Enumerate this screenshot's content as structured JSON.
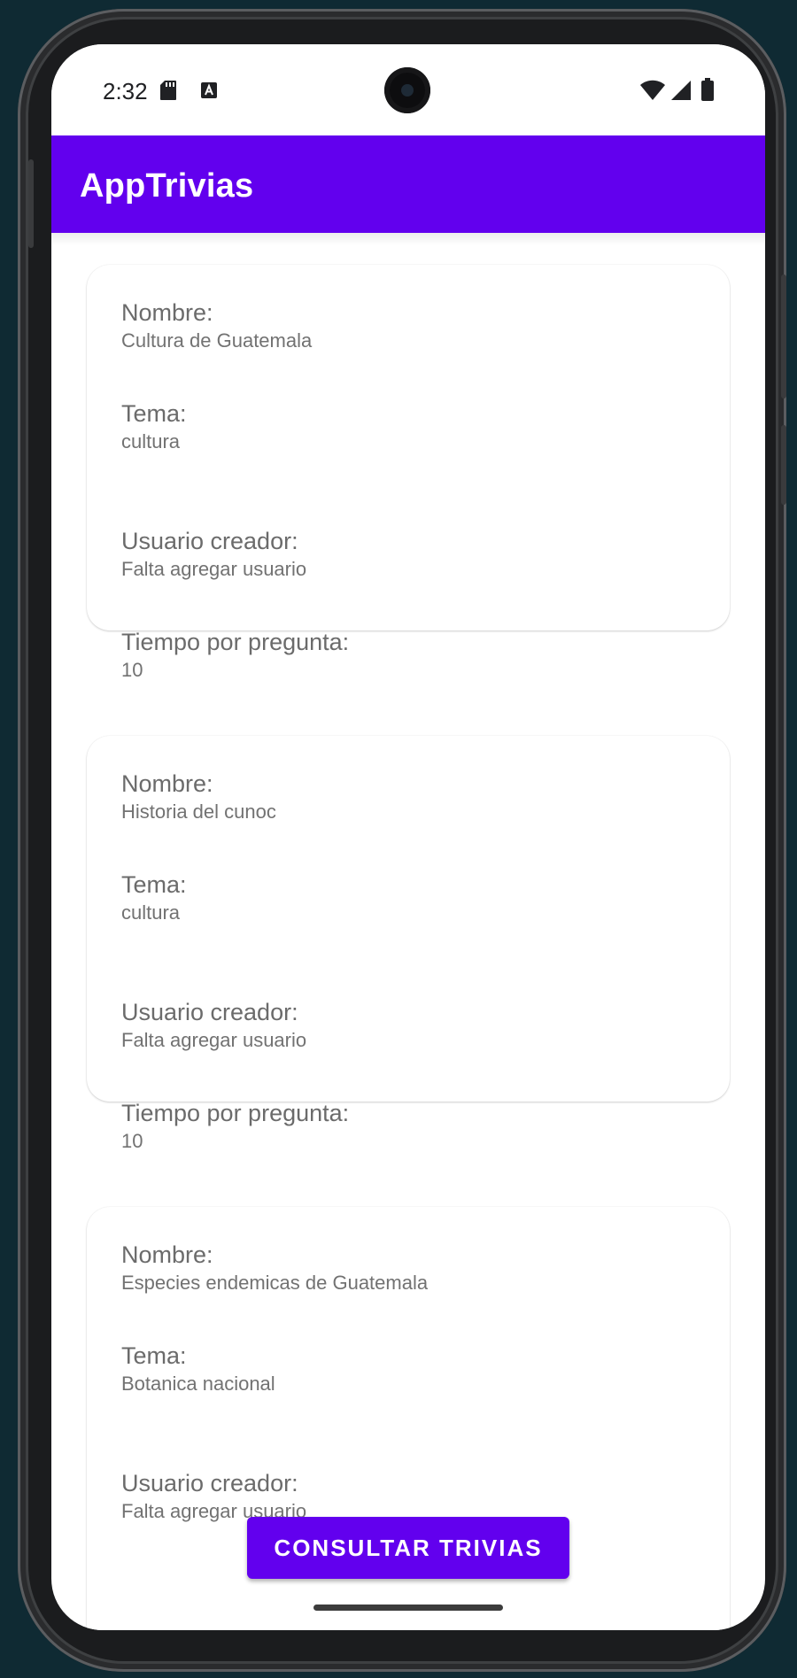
{
  "status_bar": {
    "time": "2:32",
    "icons": [
      "sd-card-icon",
      "a-icon",
      "wifi-icon",
      "signal-icon",
      "battery-icon"
    ]
  },
  "app_bar": {
    "title": "AppTrivias",
    "color": "#6200ee"
  },
  "labels": {
    "name": "Nombre:",
    "topic": "Tema:",
    "creator": "Usuario creador:",
    "time_per_question": "Tiempo por pregunta:"
  },
  "trivias": [
    {
      "name": "Cultura de Guatemala",
      "topic": "cultura",
      "creator": "Falta agregar usuario",
      "time_per_question": "10"
    },
    {
      "name": "Historia del cunoc",
      "topic": "cultura",
      "creator": "Falta agregar usuario",
      "time_per_question": "10"
    },
    {
      "name": "Especies endemicas de Guatemala",
      "topic": "Botanica nacional",
      "creator": "Falta agregar usuario"
    }
  ],
  "button": {
    "label": "CONSULTAR TRIVIAS"
  }
}
